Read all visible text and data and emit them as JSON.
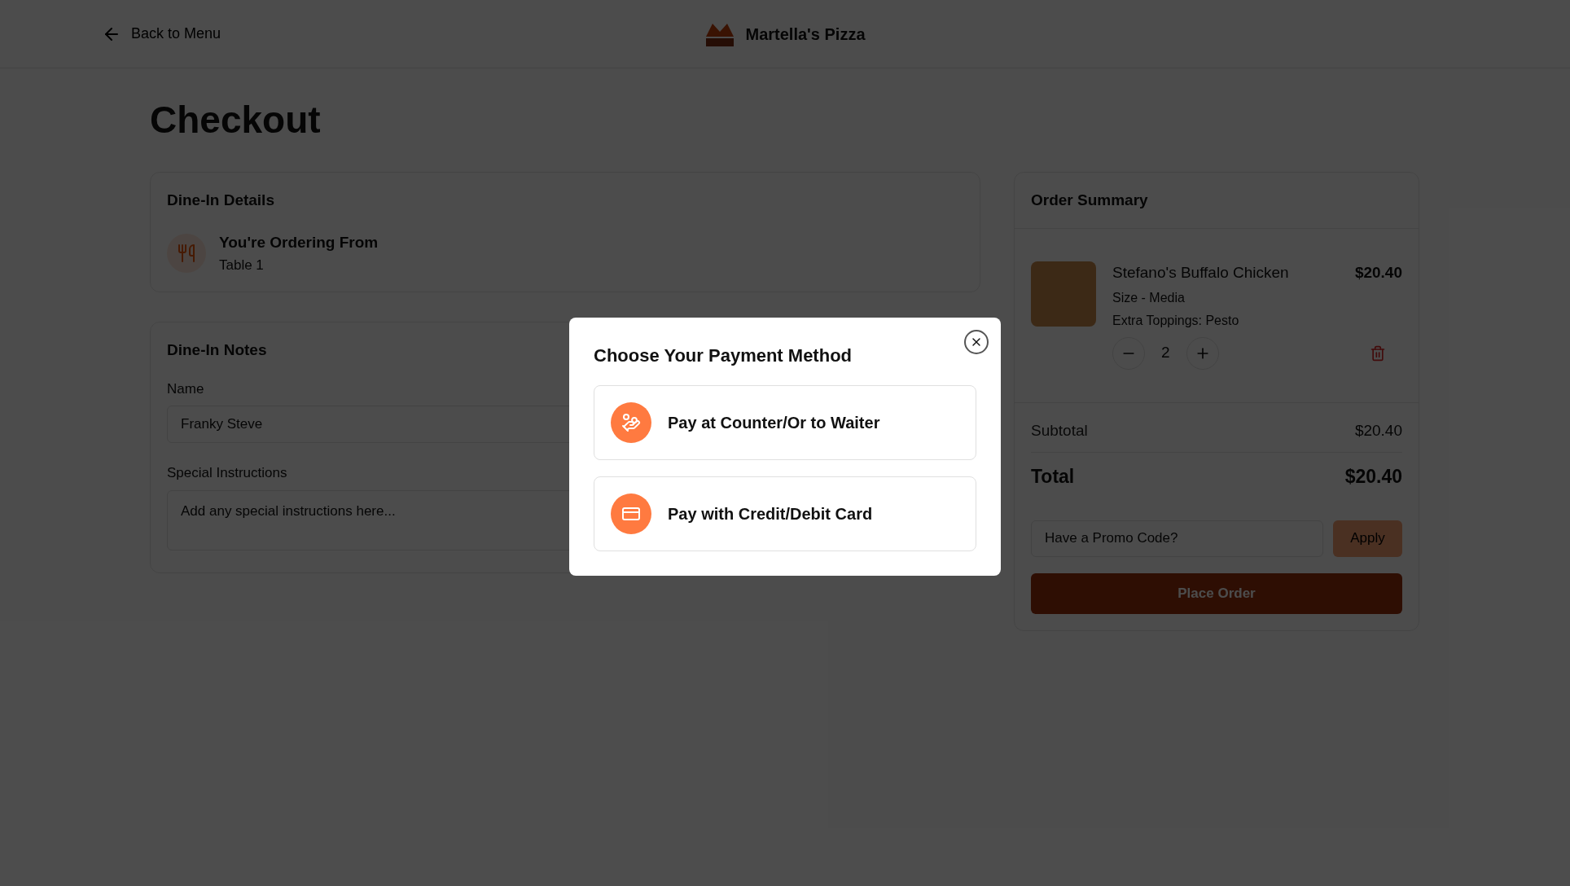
{
  "header": {
    "back_link": "Back to Menu",
    "brand": "Martella's Pizza"
  },
  "page_title": "Checkout",
  "dine_in_details": {
    "title": "Dine-In Details",
    "heading": "You're Ordering From",
    "table": "Table 1"
  },
  "dine_in_notes": {
    "title": "Dine-In Notes",
    "name_label": "Name",
    "name_value": "Franky Steve",
    "instructions_label": "Special Instructions",
    "instructions_placeholder": "Add any special instructions here..."
  },
  "order_summary": {
    "title": "Order Summary",
    "items": [
      {
        "name": "Stefano's Buffalo Chicken",
        "size": "Size - Media",
        "toppings": "Extra Toppings: Pesto",
        "quantity": "2",
        "price": "$20.40"
      }
    ],
    "subtotal_label": "Subtotal",
    "subtotal": "$20.40",
    "total_label": "Total",
    "total": "$20.40",
    "promo_placeholder": "Have a Promo Code?",
    "apply_button": "Apply",
    "place_order_button": "Place Order"
  },
  "payment_dialog": {
    "title": "Choose Your Payment Method",
    "options": [
      {
        "kind": "cash",
        "label": "Pay at Counter/Or to Waiter"
      },
      {
        "kind": "card",
        "label": "Pay with Credit/Debit Card"
      }
    ]
  }
}
